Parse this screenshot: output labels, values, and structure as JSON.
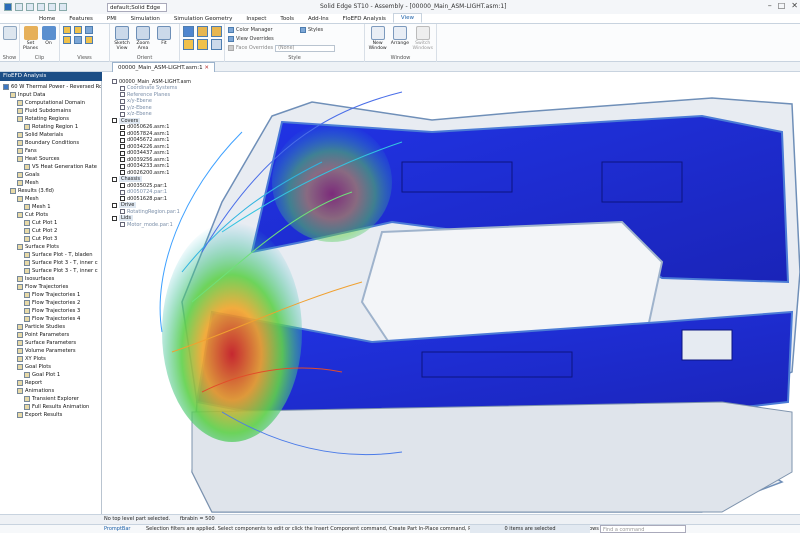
{
  "app": {
    "title": "Solid Edge ST10 - Assembly - [00000_Main_ASM-LIGHT.asm:1]",
    "quick_select": "default;Solid Edge"
  },
  "menu_tabs": [
    "Home",
    "Features",
    "PMI",
    "Simulation",
    "Simulation Geometry",
    "Inspect",
    "Tools",
    "Add-Ins",
    "FloEFD Analysis",
    "View"
  ],
  "active_tab": "View",
  "ribbon": {
    "groups": [
      {
        "label": "Show",
        "buttons": []
      },
      {
        "label": "Clip",
        "buttons": [
          {
            "label": "Set Planes"
          },
          {
            "label": "On"
          }
        ]
      },
      {
        "label": "Views",
        "buttons": [
          {
            "label": "Sketch View"
          },
          {
            "label": "Zoom Area"
          },
          {
            "label": "Fit"
          }
        ]
      },
      {
        "label": "Orient",
        "buttons": []
      },
      {
        "label": "Style",
        "buttons": []
      }
    ],
    "style_items": {
      "color_manager": "Color Manager",
      "view_overrides": "View Overrides",
      "face_overrides": "Face Overrides",
      "styles": "Styles",
      "face_override_value": "(None)"
    },
    "window": {
      "label": "Window",
      "new_window": "New Window",
      "arrange": "Arrange",
      "switch_windows": "Switch Windows"
    }
  },
  "document_tab": "00000_Main_ASM-LIGHT.asm:1",
  "left_panel": {
    "tab": "FloEFD Analysis",
    "tree": [
      {
        "label": "60 W Thermal Power - Reversed Rotat",
        "level": 0
      },
      {
        "label": "Input Data",
        "level": 1
      },
      {
        "label": "Computational Domain",
        "level": 2
      },
      {
        "label": "Fluid Subdomains",
        "level": 2
      },
      {
        "label": "Rotating Regions",
        "level": 2
      },
      {
        "label": "Rotating Region 1",
        "level": 3
      },
      {
        "label": "Solid Materials",
        "level": 2
      },
      {
        "label": "Boundary Conditions",
        "level": 2
      },
      {
        "label": "Fans",
        "level": 2
      },
      {
        "label": "Heat Sources",
        "level": 2
      },
      {
        "label": "VS Heat Generation Rate",
        "level": 3
      },
      {
        "label": "Goals",
        "level": 2
      },
      {
        "label": "Mesh",
        "level": 2
      },
      {
        "label": "Results (3.fld)",
        "level": 1
      },
      {
        "label": "Mesh",
        "level": 2
      },
      {
        "label": "Mesh 1",
        "level": 3
      },
      {
        "label": "Cut Plots",
        "level": 2
      },
      {
        "label": "Cut Plot 1",
        "level": 3
      },
      {
        "label": "Cut Plot 2",
        "level": 3
      },
      {
        "label": "Cut Plot 3",
        "level": 3
      },
      {
        "label": "Surface Plots",
        "level": 2
      },
      {
        "label": "Surface Plot - T, bladen",
        "level": 3
      },
      {
        "label": "Surface Plot 3 - T, inner c",
        "level": 3
      },
      {
        "label": "Surface Plot 3 - T, inner c",
        "level": 3
      },
      {
        "label": "Isosurfaces",
        "level": 2
      },
      {
        "label": "Flow Trajectories",
        "level": 2
      },
      {
        "label": "Flow Trajectories 1",
        "level": 3
      },
      {
        "label": "Flow Trajectories 2",
        "level": 3
      },
      {
        "label": "Flow Trajectories 3",
        "level": 3
      },
      {
        "label": "Flow Trajectories 4",
        "level": 3
      },
      {
        "label": "Particle Studies",
        "level": 2
      },
      {
        "label": "Point Parameters",
        "level": 2
      },
      {
        "label": "Surface Parameters",
        "level": 2
      },
      {
        "label": "Volume Parameters",
        "level": 2
      },
      {
        "label": "XY Plots",
        "level": 2
      },
      {
        "label": "Goal Plots",
        "level": 2
      },
      {
        "label": "Goal Plot 1",
        "level": 3
      },
      {
        "label": "Report",
        "level": 2
      },
      {
        "label": "Animations",
        "level": 2
      },
      {
        "label": "Transient Explorer",
        "level": 3
      },
      {
        "label": "Full Results Animation",
        "level": 3
      },
      {
        "label": "Export Results",
        "level": 2
      }
    ]
  },
  "pathfinder": {
    "items": [
      {
        "label": "00000_Main_ASM-LIGHT.asm",
        "type": "root"
      },
      {
        "label": "Coordinate Systems",
        "type": "dim"
      },
      {
        "label": "Reference Planes",
        "type": "dim"
      },
      {
        "label": "x/y-Ebene",
        "type": "dim"
      },
      {
        "label": "y/z-Ebene",
        "type": "dim"
      },
      {
        "label": "x/z-Ebene",
        "type": "dim"
      },
      {
        "label": "Covers",
        "type": "header"
      },
      {
        "label": "d0050626.asm:1",
        "type": "item"
      },
      {
        "label": "d0057824.asm:1",
        "type": "item"
      },
      {
        "label": "d0045672.asm:1",
        "type": "item"
      },
      {
        "label": "d0034226.asm:1",
        "type": "item"
      },
      {
        "label": "d0034437.asm:1",
        "type": "item"
      },
      {
        "label": "d0039256.asm:1",
        "type": "item"
      },
      {
        "label": "d0034233.asm:1",
        "type": "item"
      },
      {
        "label": "d0026200.asm:1",
        "type": "item"
      },
      {
        "label": "Chassis",
        "type": "header"
      },
      {
        "label": "d0035025.par:1",
        "type": "item"
      },
      {
        "label": "d0050724.par:1",
        "type": "dim"
      },
      {
        "label": "d0051628.par:1",
        "type": "item"
      },
      {
        "label": "Drive",
        "type": "header"
      },
      {
        "label": "RotatingRegion.par:1",
        "type": "dim"
      },
      {
        "label": "Lids",
        "type": "header"
      },
      {
        "label": "Motor_mode.par:1",
        "type": "dim"
      }
    ]
  },
  "status": {
    "message": "No top level part selected.",
    "fps": "fbrabin = 500"
  },
  "prompt": {
    "label": "PromptBar",
    "text": "Selection filters are applied. Select components to edit or click the Insert Component command, Create Part In-Place command, Parts Library tab or drag components from Windows Explorer.",
    "selected": "0 items are selected",
    "search_placeholder": "Find a command"
  },
  "colors": {
    "ribbon_accent": "#1a5fa8",
    "panel_header": "#1c4e86",
    "model_blue": "#1f2fd8"
  }
}
